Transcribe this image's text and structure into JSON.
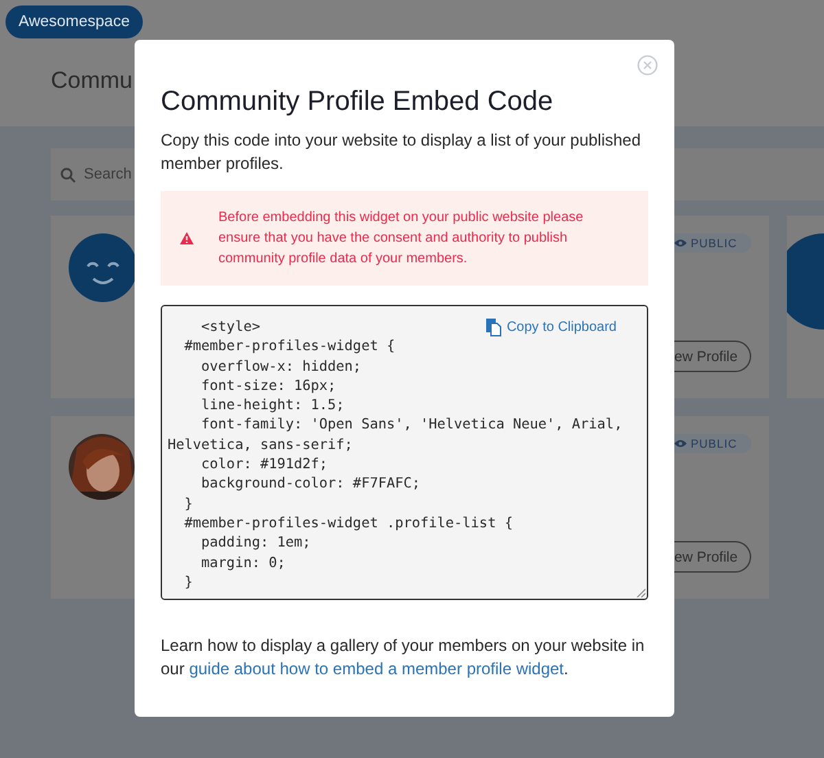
{
  "app_button": "Awesomespace",
  "page_title": "Commu",
  "search": {
    "placeholder": "Search"
  },
  "left_cards": [
    {
      "kind": "smiley"
    },
    {
      "kind": "picture"
    }
  ],
  "right_cards": [
    {
      "badge": "PUBLIC",
      "button": "ew Profile"
    },
    {
      "badge": "PUBLIC",
      "button": "ew Profile"
    }
  ],
  "far_cards": [
    {
      "kind": "avatar"
    }
  ],
  "modal": {
    "title": "Community Profile Embed Code",
    "intro": "Copy this code into your website to display a list of your published member profiles.",
    "warning": "Before embedding this widget on your public website please ensure that you have the consent and authority to publish community profile data of your members.",
    "copy_button": "Copy to Clipboard",
    "code_lines": [
      "    <style>",
      "  #member-profiles-widget {",
      "    overflow-x: hidden;",
      "    font-size: 16px;",
      "    line-height: 1.5;",
      "    font-family: 'Open Sans', 'Helvetica Neue', Arial,",
      "Helvetica, sans-serif;",
      "    color: #191d2f;",
      "    background-color: #F7FAFC;",
      "  }",
      "  #member-profiles-widget .profile-list {",
      "    padding: 1em;",
      "    margin: 0;",
      "  }"
    ],
    "footer": {
      "text": "Learn how to display a gallery of your members on your website in our ",
      "link": "guide about how to embed a member profile widget",
      "end": "."
    }
  }
}
